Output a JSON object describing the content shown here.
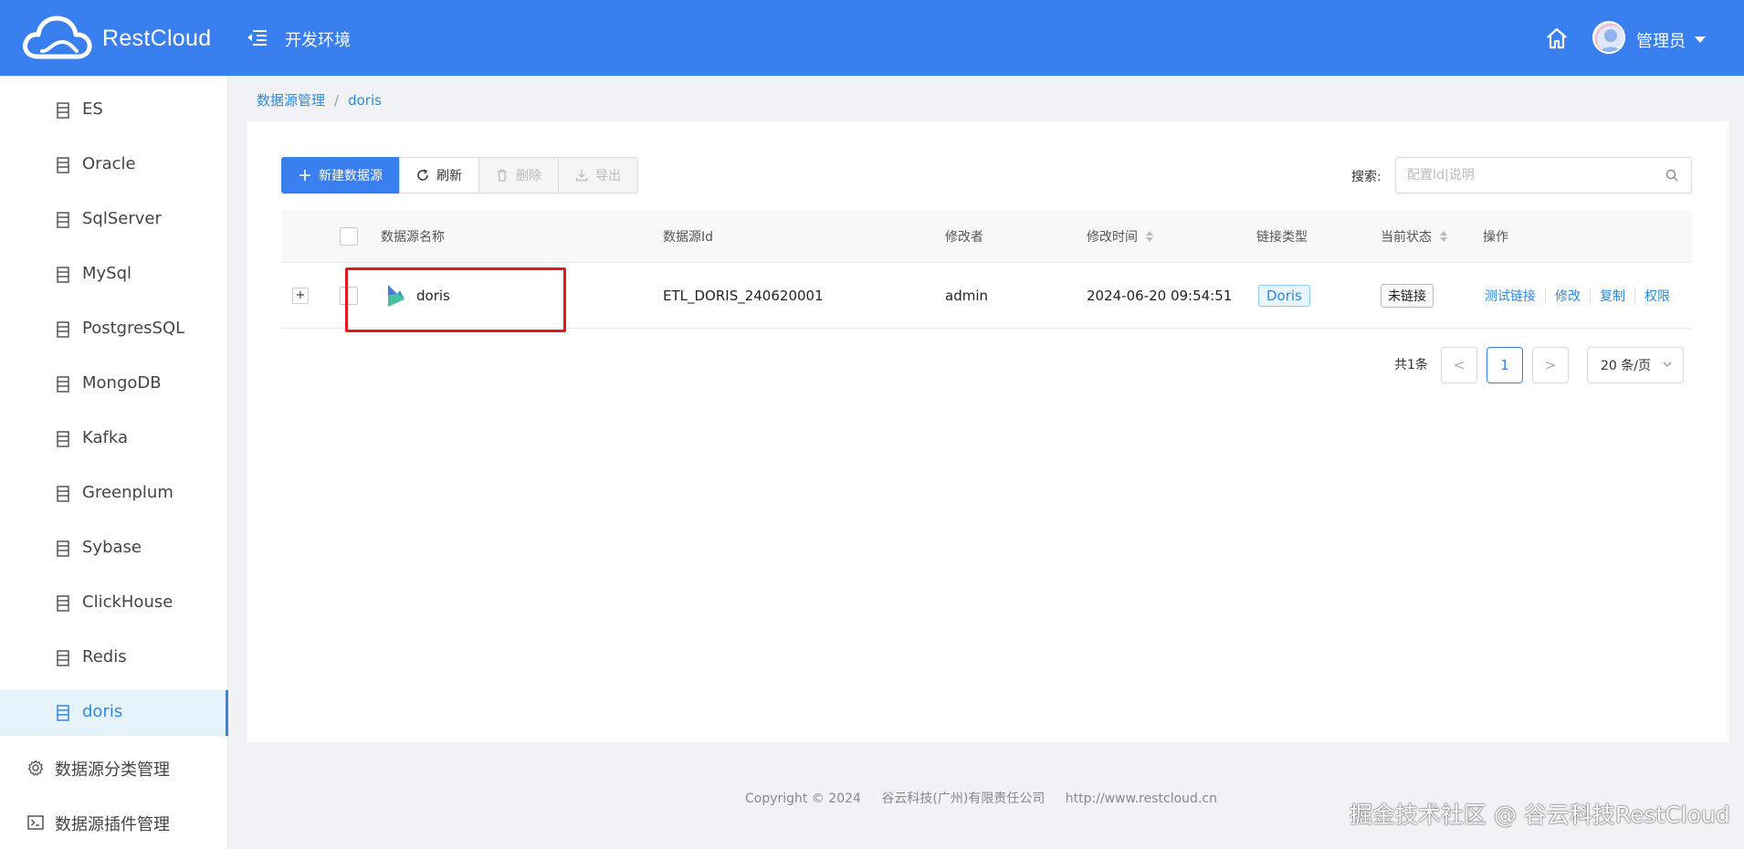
{
  "header": {
    "brand": "RestCloud",
    "env_title": "开发环境",
    "user_name": "管理员"
  },
  "sidebar": {
    "items": [
      {
        "label": "ES"
      },
      {
        "label": "Oracle"
      },
      {
        "label": "SqlServer"
      },
      {
        "label": "MySql"
      },
      {
        "label": "PostgresSQL"
      },
      {
        "label": "MongoDB"
      },
      {
        "label": "Kafka"
      },
      {
        "label": "Greenplum"
      },
      {
        "label": "Sybase"
      },
      {
        "label": "ClickHouse"
      },
      {
        "label": "Redis"
      },
      {
        "label": "doris",
        "active": true
      }
    ],
    "groups": [
      {
        "label": "数据源分类管理"
      },
      {
        "label": "数据源插件管理"
      }
    ]
  },
  "breadcrumb": {
    "root": "数据源管理",
    "separator": "/",
    "current": "doris"
  },
  "toolbar": {
    "new_label": "新建数据源",
    "refresh_label": "刷新",
    "delete_label": "删除",
    "export_label": "导出",
    "search_label": "搜索:",
    "search_placeholder": "配置Id|说明"
  },
  "table": {
    "headers": {
      "name": "数据源名称",
      "id": "数据源Id",
      "modifier": "修改者",
      "modified_time": "修改时间",
      "link_type": "链接类型",
      "status": "当前状态",
      "actions": "操作"
    },
    "rows": [
      {
        "expand": "+",
        "name": "doris",
        "id": "ETL_DORIS_240620001",
        "modifier": "admin",
        "modified_time": "2024-06-20 09:54:51",
        "link_type": "Doris",
        "status": "未链接",
        "actions": [
          "测试链接",
          "修改",
          "复制",
          "权限"
        ]
      }
    ]
  },
  "pagination": {
    "total": "共1条",
    "prev": "<",
    "current_page": "1",
    "next": ">",
    "page_size": "20 条/页"
  },
  "footer": {
    "copyright": "Copyright © 2024",
    "company": "谷云科技(广州)有限责任公司",
    "url": "http://www.restcloud.cn"
  },
  "watermark": "掘金技术社区 @ 谷云科技RestCloud",
  "colors": {
    "header_bg": "#3a7ff0",
    "accent": "#2f88dd",
    "highlight": "#e0191c"
  }
}
